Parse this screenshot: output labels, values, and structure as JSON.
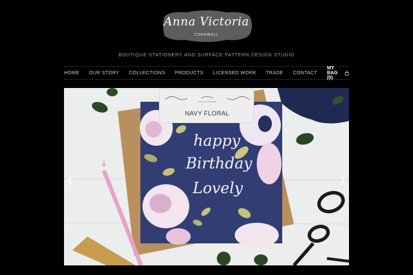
{
  "logo": {
    "script": "Anna Victoria",
    "sub": "CORNWALL"
  },
  "tagline": "BOUTIQUE STATIONERY AND SURFACE PATTERN DESIGN STUDIO",
  "nav": {
    "items": [
      "HOME",
      "OUR STORY",
      "COLLECTIONS",
      "PRODUCTS",
      "LICENSED WORK",
      "TRADE",
      "CONTACT"
    ],
    "bag": "MY BAG (0)"
  },
  "slide": {
    "product_name": "NAVY FLORAL",
    "card_lines": [
      "happy",
      "Birthday",
      "Lovely"
    ]
  },
  "colors": {
    "background": "#000000",
    "card_navy": "#2f3a6e",
    "kraft": "#b98f5e",
    "pencil_pink": "#e6a3c6"
  },
  "icons": {
    "bag": "shopping-bag-icon",
    "prev": "chevron-left-icon",
    "next": "chevron-right-icon"
  }
}
